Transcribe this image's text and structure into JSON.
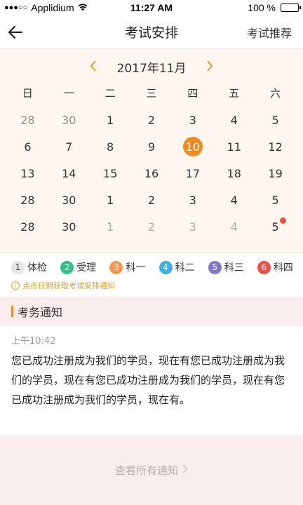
{
  "status": {
    "carrier": "Applidium",
    "time": "11:27 AM",
    "battery": "100 %"
  },
  "nav": {
    "title": "考试安排",
    "right_label": "考试推荐"
  },
  "calendar": {
    "month": "2017年11月",
    "weekdays": [
      "日",
      "一",
      "二",
      "三",
      "四",
      "五",
      "六"
    ],
    "rows": [
      [
        "28",
        "30",
        "1",
        "2",
        "3",
        "4",
        "5"
      ],
      [
        "6",
        "7",
        "8",
        "9",
        "10",
        "11",
        "12"
      ],
      [
        "13",
        "14",
        "15",
        "16",
        "17",
        "18",
        "19"
      ],
      [
        "28",
        "30",
        "1",
        "2",
        "3",
        "4",
        "5"
      ],
      [
        "28",
        "30",
        "1",
        "2",
        "3",
        "4",
        "5"
      ]
    ],
    "selected": "10"
  },
  "legend": {
    "items": [
      {
        "num": "1",
        "label": "体检",
        "color": "#e9e4e3",
        "text_color": "#444"
      },
      {
        "num": "2",
        "label": "受理",
        "color": "#2fc08a",
        "text_color": "#ffffff"
      },
      {
        "num": "3",
        "label": "科一",
        "color": "#f4974b",
        "text_color": "#ffffff"
      },
      {
        "num": "4",
        "label": "科二",
        "color": "#3bb0e6",
        "text_color": "#ffffff"
      },
      {
        "num": "5",
        "label": "科三",
        "color": "#7f78cf",
        "text_color": "#ffffff"
      },
      {
        "num": "6",
        "label": "科四",
        "color": "#ef4e43",
        "text_color": "#ffffff"
      }
    ],
    "hint": "点击日期获取考试安排通知"
  },
  "notice": {
    "header": "考务通知",
    "time": "上午10:42",
    "text": "您已成功注册成为我们的学员，现在有您已成功注册成为我们的学员，现在有您已成功注册成为我们的学员，现在有您已成功注册成为我们的学员，现在有。"
  },
  "footer": {
    "label": "查看所有通知"
  },
  "colors": {
    "accent": "#f28a1d",
    "calendar_bg": "#fdf7ef",
    "notice_bg": "#f9eded"
  }
}
